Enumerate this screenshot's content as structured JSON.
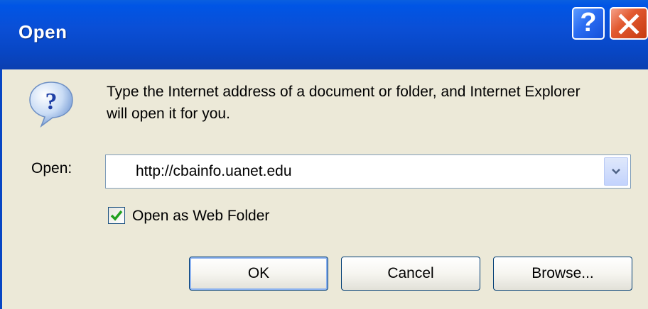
{
  "window": {
    "title": "Open",
    "help_label": "?",
    "help_icon": "question-mark",
    "close_icon": "x-close"
  },
  "message": {
    "icon": "question-bubble",
    "text": "Type the Internet address of a document or folder, and Internet Explorer will open it for you."
  },
  "open_field": {
    "label": "Open:",
    "value": "http://cbainfo.uanet.edu"
  },
  "web_folder": {
    "label": "Open as Web Folder",
    "checked": true
  },
  "buttons": {
    "ok": "OK",
    "cancel": "Cancel",
    "browse": "Browse..."
  },
  "colors": {
    "titlebar": "#0846c4",
    "dialog_bg": "#ece9d8",
    "close_button": "#e25a30",
    "checkmark": "#21a121"
  }
}
